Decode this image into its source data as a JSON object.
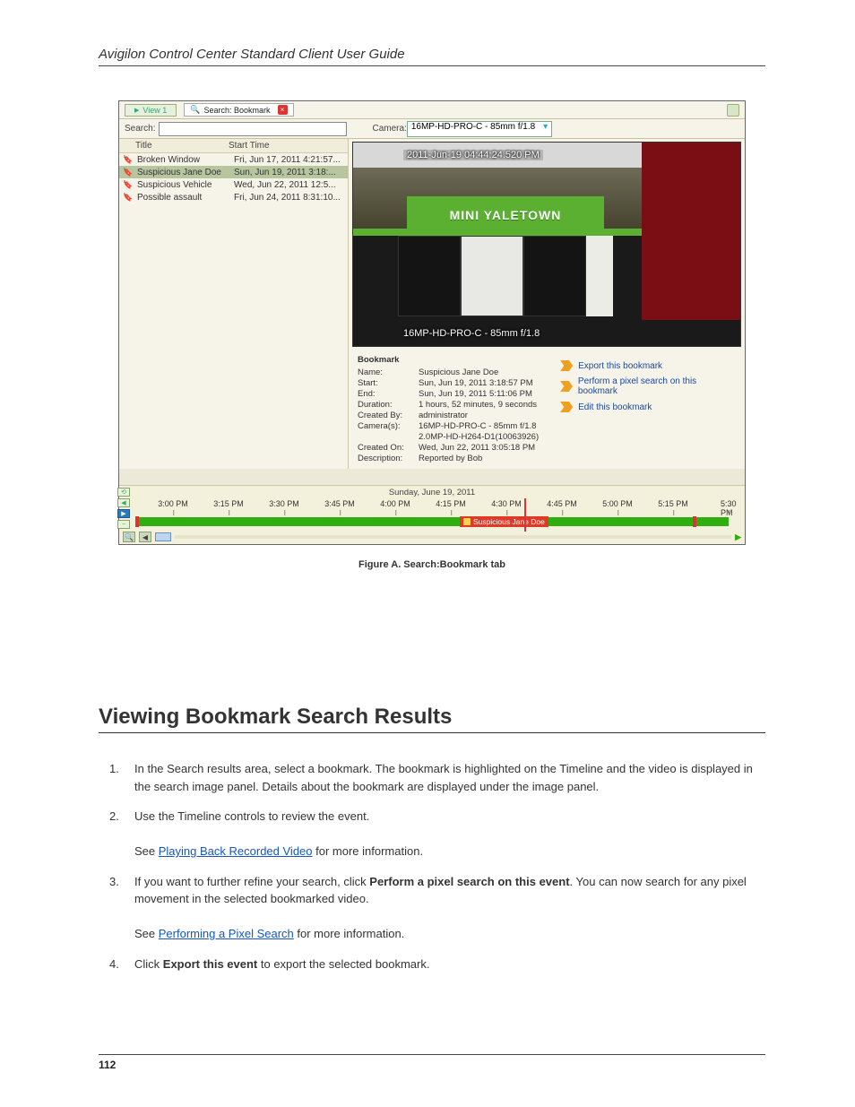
{
  "header": {
    "guide_title": "Avigilon Control Center Standard Client User Guide"
  },
  "footer": {
    "page_number": "112"
  },
  "section": {
    "heading": "Viewing Bookmark Search Results"
  },
  "figure": {
    "caption": "Figure A. Search:Bookmark tab"
  },
  "screenshot": {
    "tabs": {
      "view_label": "View 1",
      "search_label": "Search: Bookmark"
    },
    "searchbar": {
      "label": "Search:",
      "value": "",
      "camera_label": "Camera:",
      "camera_selected": "16MP-HD-PRO-C - 85mm f/1.8"
    },
    "list": {
      "header_title": "Title",
      "header_time": "Start Time",
      "rows": [
        {
          "title": "Broken Window",
          "time": "Fri, Jun 17, 2011 4:21:57...",
          "selected": false
        },
        {
          "title": "Suspicious Jane Doe",
          "time": "Sun, Jun 19, 2011 3:18:...",
          "selected": true
        },
        {
          "title": "Suspicious Vehicle",
          "time": "Wed, Jun 22, 2011 12:5...",
          "selected": false
        },
        {
          "title": "Possible assault",
          "time": "Fri, Jun 24, 2011 8:31:10...",
          "selected": false
        }
      ]
    },
    "video": {
      "timestamp": "2011-Jun-19 04:44:24.520 PM",
      "sign_text": "MINI YALETOWN",
      "camera_overlay": "16MP-HD-PRO-C - 85mm f/1.8"
    },
    "details": {
      "heading": "Bookmark",
      "fields": {
        "name_k": "Name:",
        "name_v": "Suspicious Jane Doe",
        "start_k": "Start:",
        "start_v": "Sun, Jun 19, 2011 3:18:57 PM",
        "end_k": "End:",
        "end_v": "Sun, Jun 19, 2011 5:11:06 PM",
        "duration_k": "Duration:",
        "duration_v": "1 hours, 52 minutes, 9 seconds",
        "createdby_k": "Created By:",
        "createdby_v": "administrator",
        "cameras_k": "Camera(s):",
        "cameras_v": "16MP-HD-PRO-C - 85mm f/1.8",
        "cameras_v2": "2.0MP-HD-H264-D1(10063926)",
        "createdon_k": "Created On:",
        "createdon_v": "Wed, Jun 22, 2011 3:05:18 PM",
        "desc_k": "Description:",
        "desc_v": "Reported by Bob"
      },
      "actions": {
        "export": "Export this bookmark",
        "pixel": "Perform a pixel search on this bookmark",
        "edit": "Edit this bookmark"
      }
    },
    "timeline": {
      "date": "Sunday, June 19, 2011",
      "ticks": [
        "3:00 PM",
        "3:15 PM",
        "3:30 PM",
        "3:45 PM",
        "4:00 PM",
        "4:15 PM",
        "4:30 PM",
        "4:45 PM",
        "5:00 PM",
        "5:15 PM",
        "5:30 PM"
      ],
      "bookmark_tag": "Suspicious Jane Doe",
      "zoom_minus": "−",
      "zoom_icon": "🔍",
      "arrow_left": "◀",
      "arrow_right": "▶"
    }
  },
  "steps": {
    "s1": "In the Search results area, select a bookmark. The bookmark is highlighted on the Timeline and the video is displayed in the search image panel. Details about the bookmark are displayed under the image panel.",
    "s2_a": "Use the Timeline controls to review the event.",
    "s2_b": "See ",
    "s2_link": "Playing Back Recorded Video",
    "s2_c": " for more information.",
    "s3_a": "If you want to further refine your search, click ",
    "s3_b": "Perform a pixel search on this event",
    "s3_c": ". You can now search for any pixel movement in the selected bookmarked video.",
    "s3_d": "See ",
    "s3_link": "Performing a Pixel Search",
    "s3_e": " for more information.",
    "s4_a": "Click ",
    "s4_b": "Export this event",
    "s4_c": " to export the selected bookmark."
  }
}
